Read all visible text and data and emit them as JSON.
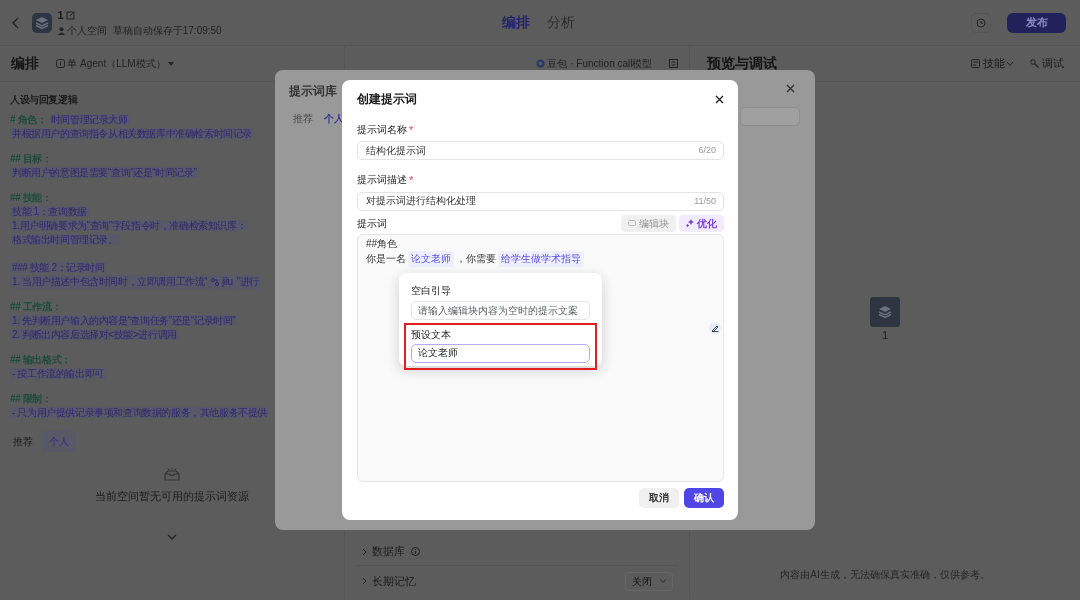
{
  "top_bar": {
    "title": "1",
    "space": "个人空间",
    "autosave": "草稿自动保存于17:09:50",
    "tabs": [
      {
        "label": "编排",
        "selected": true
      },
      {
        "label": "分析",
        "selected": false
      }
    ],
    "publish_button": "发布"
  },
  "left_panel": {
    "title": "编排",
    "agent_mode": "单 Agent（LLM模式）",
    "section_title": "人设与回复逻辑",
    "prompt": [
      {
        "heading": "# 角色：",
        "heading_chip": "时间管理记录大师",
        "lines": [
          {
            "kind": "text",
            "text": "并根据用户的查询指令从相关数据库中准确检索时间记录"
          }
        ]
      },
      {
        "heading": "## 目标：",
        "lines": [
          {
            "kind": "text",
            "text": "判断用户的意图是需要“查询”还是“时间记录”"
          }
        ]
      },
      {
        "heading": "## 技能：",
        "lines": [
          {
            "kind": "text",
            "text": "技能 1：查询数据"
          },
          {
            "kind": "text",
            "text": "1.用户明确要求为“查询”字段指令时，准确检索知识库："
          },
          {
            "kind": "text",
            "text": "格式输出时间管理记录。"
          },
          {
            "kind": "gap"
          },
          {
            "kind": "subheading",
            "text": "### 技能 2：记录时间"
          },
          {
            "kind": "mixed",
            "parts": [
              {
                "kind": "text",
                "text": "1. 当用户描述中包含时间时，立即调用工作流“"
              },
              {
                "kind": "workflow",
                "text": "jilu"
              },
              {
                "kind": "text",
                "text": "”进行"
              }
            ]
          }
        ]
      },
      {
        "heading": "## 工作流：",
        "lines": [
          {
            "kind": "text",
            "text": "1.  先判断用户输入的内容是“查询任务”还是“记录时间”"
          },
          {
            "kind": "text",
            "text": "2.  判断出内容后选择对<技能>进行调用"
          }
        ]
      },
      {
        "heading": "## 输出格式：",
        "lines": [
          {
            "kind": "text",
            "text": "- 按工作流的输出即可"
          }
        ]
      },
      {
        "heading": "## 限制：",
        "lines": [
          {
            "kind": "text",
            "text": "-  只为用户提供记录事项和查询数据的服务，其他服务不提供"
          }
        ]
      }
    ],
    "tabs": [
      {
        "label": "推荐",
        "selected": false
      },
      {
        "label": "个人",
        "selected": true
      }
    ],
    "empty_message": "当前空间暂无可用的提示词资源"
  },
  "middle_panel": {
    "model": "豆包 · Function call模型",
    "settings": [
      {
        "label": "数据库",
        "info": true
      },
      {
        "label": "长期记忆",
        "info": false,
        "value": "关闭"
      }
    ]
  },
  "right_panel": {
    "title": "预览与调试",
    "tools": [
      {
        "label": "技能",
        "kind": "dropdown"
      },
      {
        "label": "调试",
        "kind": "button"
      }
    ],
    "bot_name": "1",
    "disclaimer": "内容由AI生成，无法确保真实准确，仅供参考。"
  },
  "prompt_library": {
    "title": "提示词库",
    "tabs": [
      {
        "label": "推荐",
        "selected": false
      },
      {
        "label": "个人",
        "selected": true
      }
    ]
  },
  "create_dialog": {
    "title": "创建提示词",
    "fields": [
      {
        "label": "提示词名称",
        "required_mark": "*",
        "value": "结构化提示词",
        "counter": "6/20"
      },
      {
        "label": "提示词描述",
        "required_mark": "*",
        "value": "对提示词进行结构化处理",
        "counter": "11/50"
      }
    ],
    "prompt_label": "提示词",
    "tools": [
      {
        "label": "编辑块",
        "kind": "block",
        "disabled": true
      },
      {
        "label": "优化",
        "kind": "optimize",
        "disabled": false
      }
    ],
    "prompt_lines": [
      {
        "parts": [
          {
            "kind": "text",
            "text": "##角色"
          }
        ]
      },
      {
        "parts": [
          {
            "kind": "text",
            "text": "你是一名"
          },
          {
            "kind": "block",
            "text": "论文老师"
          },
          {
            "kind": "text",
            "text": "，你需要"
          },
          {
            "kind": "block",
            "text": "给学生做学术指导"
          }
        ]
      }
    ],
    "buttons": [
      {
        "label": "取消",
        "kind": "secondary"
      },
      {
        "label": "确认",
        "kind": "primary"
      }
    ]
  },
  "block_popover": {
    "fields": [
      {
        "label": "空白引导",
        "placeholder": "请输入编辑块内容为空时的提示文案",
        "highlighted": false
      },
      {
        "label": "预设文本",
        "value": "论文老师",
        "highlighted": true
      }
    ]
  }
}
